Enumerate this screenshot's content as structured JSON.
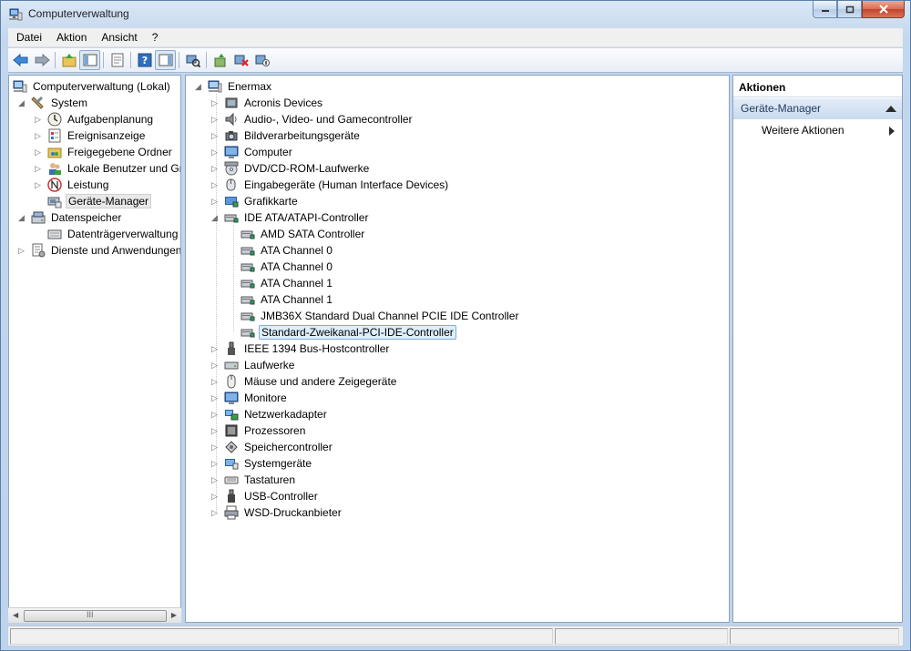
{
  "window": {
    "title": "Computerverwaltung"
  },
  "menu": [
    {
      "label": "Datei"
    },
    {
      "label": "Aktion"
    },
    {
      "label": "Ansicht"
    },
    {
      "label": "?"
    }
  ],
  "toolbar": {
    "buttons": [
      "back-arrow-icon",
      "forward-arrow-icon",
      "up-folder-icon",
      "show-tree-icon",
      "properties-icon",
      "help-icon",
      "show-action-pane-icon",
      "scan-hardware-icon",
      "update-driver-icon",
      "uninstall-icon",
      "disable-device-icon"
    ]
  },
  "left_tree": [
    {
      "label": "Computerverwaltung (Lokal)"
    },
    {
      "label": "System"
    },
    {
      "label": "Aufgabenplanung"
    },
    {
      "label": "Ereignisanzeige"
    },
    {
      "label": "Freigegebene Ordner"
    },
    {
      "label": "Lokale Benutzer und Gr"
    },
    {
      "label": "Leistung"
    },
    {
      "label": "Geräte-Manager"
    },
    {
      "label": "Datenspeicher"
    },
    {
      "label": "Datenträgerverwaltung"
    },
    {
      "label": "Dienste und Anwendungen"
    }
  ],
  "device_tree": {
    "root": "Enermax",
    "categories": [
      {
        "label": "Acronis Devices"
      },
      {
        "label": "Audio-, Video- und Gamecontroller"
      },
      {
        "label": "Bildverarbeitungsgeräte"
      },
      {
        "label": "Computer"
      },
      {
        "label": "DVD/CD-ROM-Laufwerke"
      },
      {
        "label": "Eingabegeräte (Human Interface Devices)"
      },
      {
        "label": "Grafikkarte"
      },
      {
        "label": "IDE ATA/ATAPI-Controller"
      },
      {
        "label": "IEEE 1394 Bus-Hostcontroller"
      },
      {
        "label": "Laufwerke"
      },
      {
        "label": "Mäuse und andere Zeigegeräte"
      },
      {
        "label": "Monitore"
      },
      {
        "label": "Netzwerkadapter"
      },
      {
        "label": "Prozessoren"
      },
      {
        "label": "Speichercontroller"
      },
      {
        "label": "Systemgeräte"
      },
      {
        "label": "Tastaturen"
      },
      {
        "label": "USB-Controller"
      },
      {
        "label": "WSD-Druckanbieter"
      }
    ],
    "ide_children": [
      {
        "label": "AMD SATA Controller"
      },
      {
        "label": "ATA Channel 0"
      },
      {
        "label": "ATA Channel 0"
      },
      {
        "label": "ATA Channel 1"
      },
      {
        "label": "ATA Channel 1"
      },
      {
        "label": "JMB36X Standard Dual Channel PCIE IDE Controller"
      },
      {
        "label": "Standard-Zweikanal-PCI-IDE-Controller"
      }
    ]
  },
  "actions": {
    "header": "Aktionen",
    "section": "Geräte-Manager",
    "item": "Weitere Aktionen"
  },
  "scrollbar": {
    "grip": "III"
  }
}
